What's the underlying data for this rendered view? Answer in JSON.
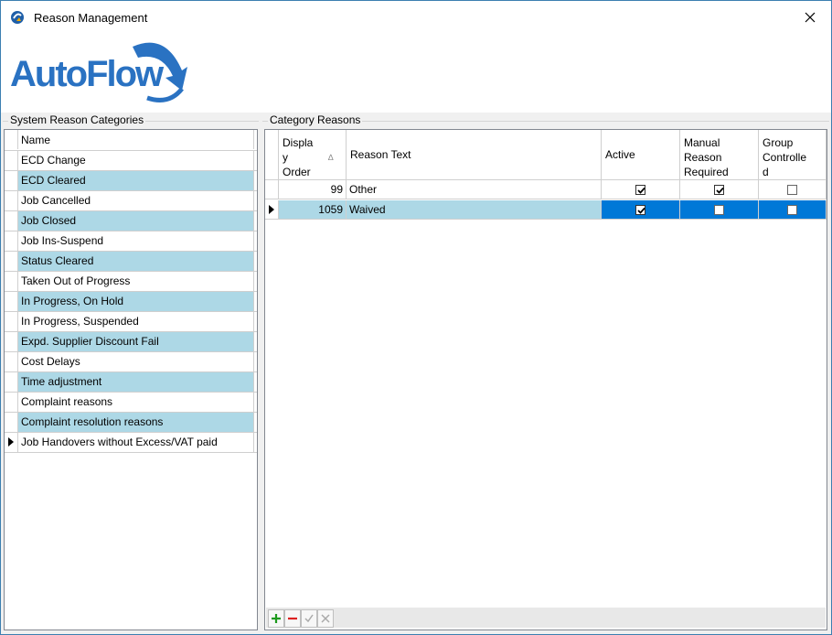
{
  "window": {
    "title": "Reason Management"
  },
  "logo": {
    "text": "AutoFlow"
  },
  "left_panel": {
    "group_label": "System Reason Categories",
    "column_header": "Name",
    "items": [
      {
        "label": "ECD Change"
      },
      {
        "label": "ECD Cleared"
      },
      {
        "label": "Job Cancelled"
      },
      {
        "label": "Job Closed"
      },
      {
        "label": "Job Ins-Suspend"
      },
      {
        "label": "Status Cleared"
      },
      {
        "label": "Taken Out of Progress"
      },
      {
        "label": "In Progress, On Hold"
      },
      {
        "label": "In Progress, Suspended"
      },
      {
        "label": "Expd. Supplier Discount Fail"
      },
      {
        "label": "Cost Delays"
      },
      {
        "label": "Time adjustment"
      },
      {
        "label": "Complaint reasons"
      },
      {
        "label": "Complaint resolution reasons"
      },
      {
        "label": "Job Handovers without Excess/VAT paid"
      }
    ],
    "selected_index": 14
  },
  "right_panel": {
    "group_label": "Category  Reasons",
    "columns": {
      "display_order": "Displa\ny\nOrder",
      "sort_indicator": "∆",
      "reason_text": "Reason Text",
      "active": "Active",
      "manual_reason_required": "Manual\nReason\nRequired",
      "group_controlled": "Group\nControlle\nd"
    },
    "rows": [
      {
        "display_order": "99",
        "reason_text": "Other",
        "active": true,
        "manual_reason_required": true,
        "group_controlled": false
      },
      {
        "display_order": "1059",
        "reason_text": "Waived",
        "active": true,
        "manual_reason_required": false,
        "group_controlled": false
      }
    ],
    "selected_index": 1
  },
  "toolbar": {
    "add_icon": "plus-icon",
    "remove_icon": "minus-icon",
    "confirm_icon": "check-icon",
    "cancel_icon": "x-icon"
  },
  "colors": {
    "accent": "#2a72c2",
    "alt_row": "#add8e6",
    "selection": "#0078d7"
  }
}
